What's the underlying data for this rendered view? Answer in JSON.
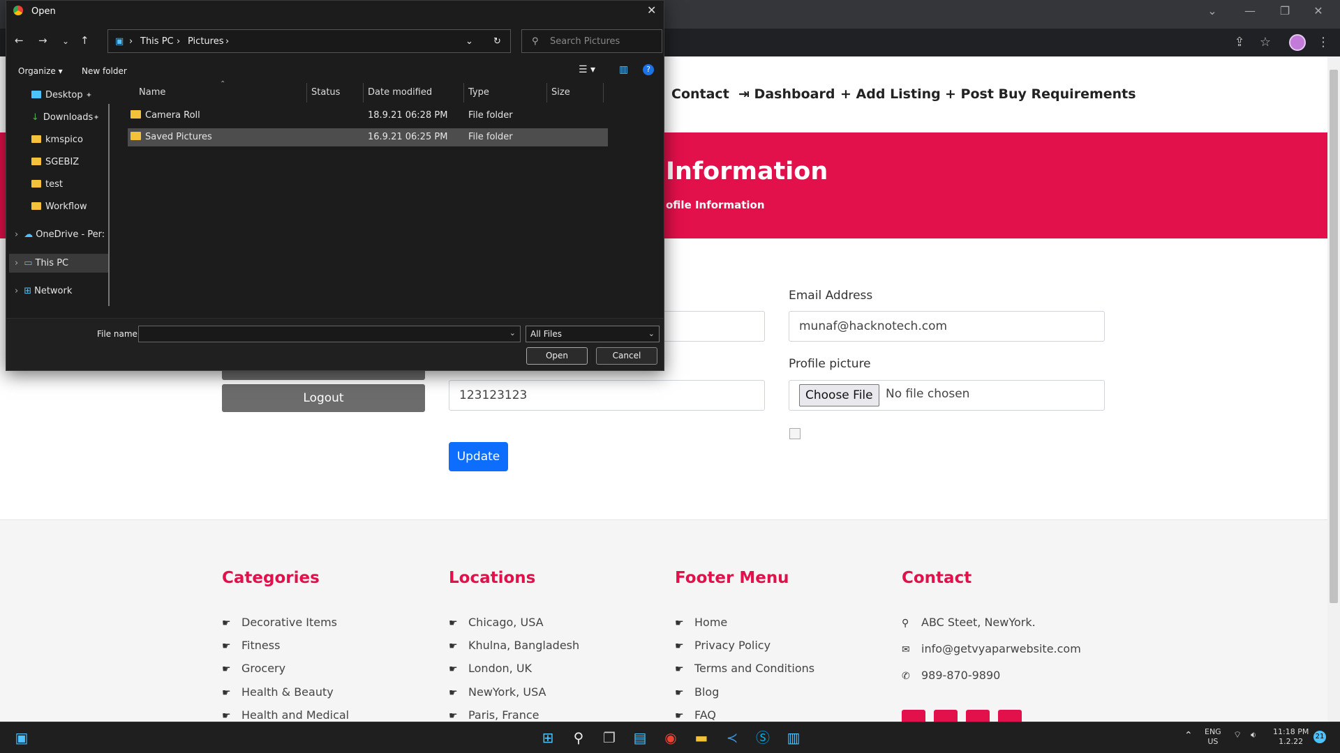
{
  "browser": {
    "window_controls": [
      "⌄",
      "—",
      "❐",
      "✕"
    ]
  },
  "nav": {
    "items": [
      {
        "icon": "",
        "label": "Contact"
      },
      {
        "icon": "⇥",
        "label": "Dashboard"
      },
      {
        "icon": "+",
        "label": "Add Listing"
      },
      {
        "icon": "+",
        "label": "Post Buy Requirements"
      }
    ]
  },
  "hero": {
    "title": "Information",
    "breadcrumb": "ofile Information"
  },
  "form": {
    "email_label": "Email Address",
    "email_value": "munaf@hacknotech.com",
    "phone_value": "123123123",
    "profile_label": "Profile picture",
    "choose_file": "Choose File",
    "no_file": "No file chosen",
    "update": "Update",
    "logout": "Logout"
  },
  "footer": {
    "categories": {
      "title": "Categories",
      "items": [
        "Decorative Items",
        "Fitness",
        "Grocery",
        "Health & Beauty",
        "Health and Medical"
      ]
    },
    "locations": {
      "title": "Locations",
      "items": [
        "Chicago, USA",
        "Khulna, Bangladesh",
        "London, UK",
        "NewYork, USA",
        "Paris, France"
      ]
    },
    "menu": {
      "title": "Footer Menu",
      "items": [
        "Home",
        "Privacy Policy",
        "Terms and Conditions",
        "Blog",
        "FAQ"
      ]
    },
    "contact": {
      "title": "Contact",
      "address": "ABC Steet, NewYork.",
      "email": "info@getvyaparwebsite.com",
      "phone": "989-870-9890"
    }
  },
  "dialog": {
    "title": "Open",
    "breadcrumb": [
      "This PC",
      "Pictures"
    ],
    "search_placeholder": "Search Pictures",
    "organize": "Organize ▾",
    "new_folder": "New folder",
    "nav_items": [
      "Desktop",
      "Downloads",
      "kmspico",
      "SGEBIZ",
      "test",
      "Workflow",
      "OneDrive - Per:",
      "This PC",
      "Network"
    ],
    "columns": [
      "Name",
      "Status",
      "Date modified",
      "Type",
      "Size"
    ],
    "rows": [
      {
        "name": "Camera Roll",
        "date": "18.9.21 06:28 PM",
        "type": "File folder"
      },
      {
        "name": "Saved Pictures",
        "date": "16.9.21 06:25 PM",
        "type": "File folder"
      }
    ],
    "file_name_label": "File name:",
    "filter": "All Files",
    "open": "Open",
    "cancel": "Cancel"
  },
  "taskbar": {
    "lang": "ENG",
    "region": "US",
    "time": "11:18 PM",
    "date": "1.2.22",
    "badge": "21"
  }
}
